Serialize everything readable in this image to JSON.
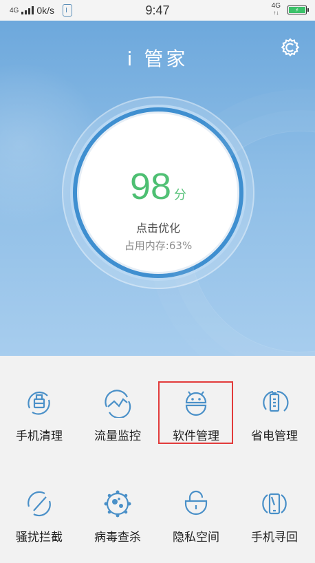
{
  "status_bar": {
    "network": "4G",
    "speed": "0k/s",
    "time": "9:47",
    "network_right": "4G"
  },
  "app": {
    "title": "i 管家"
  },
  "score": {
    "value": "98",
    "unit": "分",
    "action_label": "点击优化",
    "memory_label": "占用内存:63%"
  },
  "tools": [
    {
      "label": "手机清理",
      "icon": "broom-icon"
    },
    {
      "label": "流量监控",
      "icon": "traffic-chart-icon"
    },
    {
      "label": "软件管理",
      "icon": "android-icon",
      "highlighted": true
    },
    {
      "label": "省电管理",
      "icon": "battery-icon"
    },
    {
      "label": "骚扰拦截",
      "icon": "block-icon"
    },
    {
      "label": "病毒查杀",
      "icon": "virus-icon"
    },
    {
      "label": "隐私空间",
      "icon": "lock-icon"
    },
    {
      "label": "手机寻回",
      "icon": "phone-find-icon"
    }
  ],
  "colors": {
    "accent_blue": "#4a90c8",
    "score_green": "#4dbf72",
    "highlight_red": "#e23b3b"
  }
}
